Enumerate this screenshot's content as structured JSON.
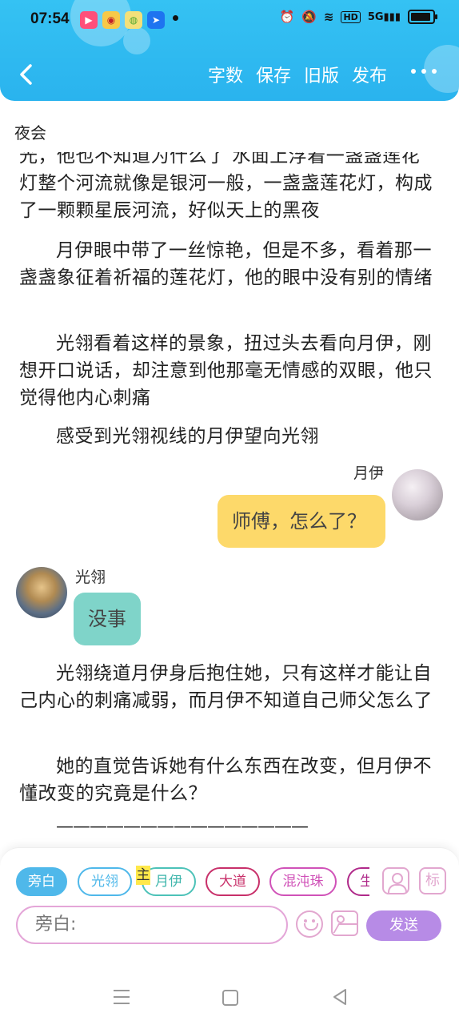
{
  "status_bar": {
    "time": "07:54",
    "network": "5G",
    "hd": "HD"
  },
  "nav": {
    "actions": [
      "字数",
      "保存",
      "旧版",
      "发布"
    ]
  },
  "chapter_title": "夜会",
  "story": {
    "para0": "光，他也不知道为什么了 水面上浮着一盏盏莲花灯整个河流就像是银河一般，一盏盏莲花灯，构成了一颗颗星辰河流，好似天上的黑夜",
    "para1": "月伊眼中带了一丝惊艳，但是不多，看着那一盏盏象征着祈福的莲花灯，他的眼中没有别的情绪",
    "para2": "光翎看着这样的景象，扭过头去看向月伊，刚想开口说话，却注意到他那毫无情感的双眼，他只觉得他内心刺痛",
    "para3": "感受到光翎视线的月伊望向光翎",
    "msg1": {
      "speaker": "月伊",
      "text": "师傅，怎么了？"
    },
    "msg2": {
      "speaker": "光翎",
      "text": "没事"
    },
    "para4": "光翎绕道月伊身后抱住她，只有这样才能让自己内心的刺痛减弱，而月伊不知道自己师父怎么了",
    "para5": "她的直觉告诉她有什么东西在改变，但月伊不懂改变的究竟是什么？",
    "divider": "———————————————"
  },
  "composer": {
    "chips": [
      "旁白",
      "光翎",
      "月伊",
      "大道",
      "混沌珠",
      "生"
    ],
    "main_tag": "主",
    "tag_icon_label": "标",
    "input_placeholder": "旁白:",
    "send_label": "发送"
  },
  "colors": {
    "header": "#35c2f3",
    "bubble_yellow": "#fdd96a",
    "bubble_teal": "#7fd4c9",
    "send": "#b78be6"
  }
}
